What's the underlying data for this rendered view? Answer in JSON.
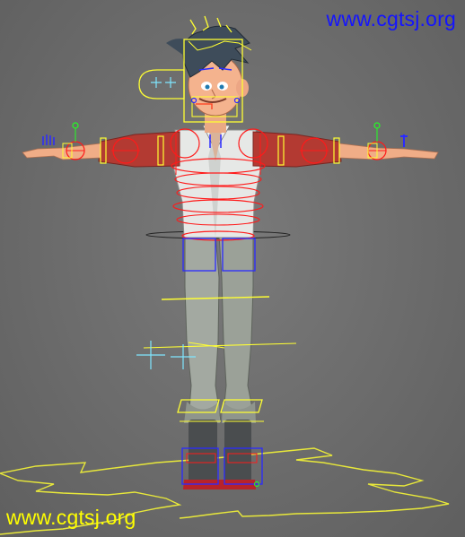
{
  "watermark_top": "www.cgtsj.org",
  "watermark_bottom": "www.cgtsj.org",
  "colors": {
    "viewport_bg": "#6e6e6e",
    "watermark_top": "#1414ff",
    "watermark_bottom": "#ffff00",
    "rig_red": "#ff1a1a",
    "rig_yellow": "#ffff33",
    "rig_blue": "#1a1aff",
    "rig_cyan": "#7fe6ff",
    "rig_green": "#22ff22",
    "shirt": "#e8e8e8",
    "sleeves": "#b53a32",
    "pants": "#9ea49c",
    "skin": "#f2b08a",
    "hair": "#3c4a5a"
  },
  "scene": {
    "character": "t-pose-rigged-character",
    "view": "front-perspective"
  }
}
